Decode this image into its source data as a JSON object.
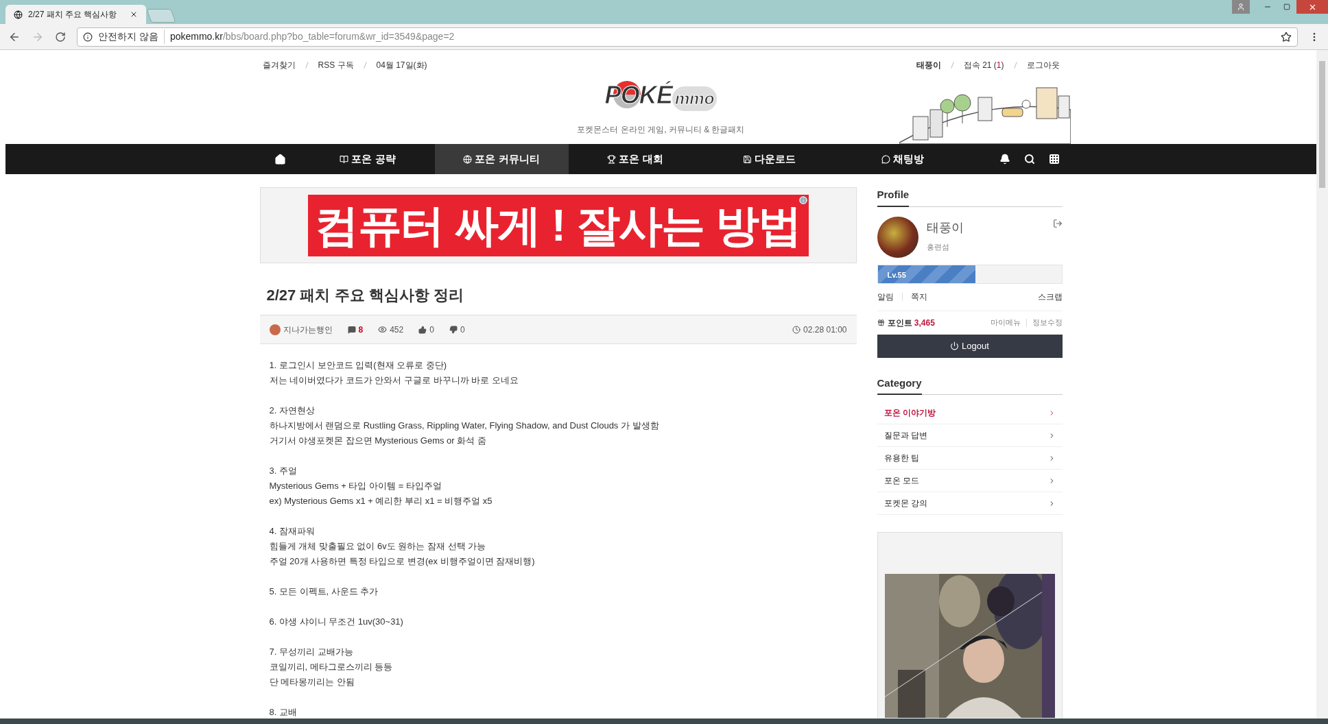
{
  "browser": {
    "tab_title": "2/27 패치 주요 핵심사항",
    "security": "안전하지 않음",
    "host": "pokemmo.kr",
    "path": "/bbs/board.php?bo_table=forum&wr_id=3549&page=2"
  },
  "top_links": [
    "즐겨찾기",
    "RSS 구독",
    "04월 17일(화)"
  ],
  "user_links": {
    "name": "태풍이",
    "online_prefix": "접속 21 (",
    "online_count": "1",
    "online_suffix": ")",
    "logout": "로그아웃"
  },
  "logo": {
    "part1": "POKÉ",
    "part2": "mmo",
    "tagline": "포켓몬스터 온라인 게임, 커뮤니티 & 한글패치"
  },
  "nav": [
    {
      "kind": "home",
      "selected": false
    },
    {
      "kind": "book",
      "label": "포온 공략",
      "selected": false
    },
    {
      "kind": "globe",
      "label": "포온 커뮤니티",
      "selected": true
    },
    {
      "kind": "trophy",
      "label": "포온 대회",
      "selected": false
    },
    {
      "kind": "save",
      "label": "다운로드",
      "selected": false
    },
    {
      "kind": "chat",
      "label": "채팅방",
      "selected": false
    }
  ],
  "banner": "컴퓨터 싸게 ! 잘사는 방법",
  "post": {
    "title": "2/27 패치 주요 핵심사항 정리",
    "author": "지나가는행인",
    "comments": "8",
    "views": "452",
    "likes": "0",
    "dislikes": "0",
    "date": "02.28 01:00",
    "paragraphs": [
      [
        "1. 로그인시 보안코드 입력(현재 오류로 중단)",
        "저는 네이버였다가 코드가 안와서 구글로 바꾸니까 바로 오네요"
      ],
      [
        "2. 자연현상",
        "하나지방에서 랜덤으로  Rustling Grass, Rippling Water, Flying Shadow, and Dust Clouds 가 발생함",
        "거기서 야생포켓몬 잡으면 Mysterious Gems or 화석 줌"
      ],
      [
        "3. 주얼",
        "Mysterious Gems + 타입 아이템 = 타입주얼",
        "ex) Mysterious Gems x1 + 예리한 부리 x1 = 비행주얼 x5"
      ],
      [
        "4. 잠재파워",
        "힘들게 개체 맞출필요 없이 6v도 원하는 잠재 선택 가능",
        "주얼 20개 사용하면 특정 타입으로 변경(ex 비행주얼이면 잠재비행)"
      ],
      [
        "5. 모든 이펙트, 사운드 추가"
      ],
      [
        "6. 야생 샤이니 무조건 1uv(30~31)"
      ],
      [
        "7. 무성끼리 교배가능",
        "코일끼리, 메타그로스끼리 등등",
        "단 메타몽끼리는 안됨"
      ],
      [
        "8. 교배"
      ]
    ]
  },
  "profile": {
    "heading": "Profile",
    "name": "태풍이",
    "rank": "홍련섬",
    "level_text": "Lv.55",
    "level": 0.53,
    "links": [
      "알림",
      "쪽지"
    ],
    "scrap": "스크랩",
    "points_label": "포인트",
    "points_value": "3,465",
    "my_menu": "마이메뉴",
    "edit": "정보수정",
    "logout": "Logout"
  },
  "category": {
    "heading": "Category",
    "items": [
      {
        "label": "포온 이야기방",
        "selected": true
      },
      {
        "label": "질문과 답변",
        "selected": false
      },
      {
        "label": "유용한 팁",
        "selected": false
      },
      {
        "label": "포온 모드",
        "selected": false
      },
      {
        "label": "포켓몬 강의",
        "selected": false
      }
    ]
  }
}
